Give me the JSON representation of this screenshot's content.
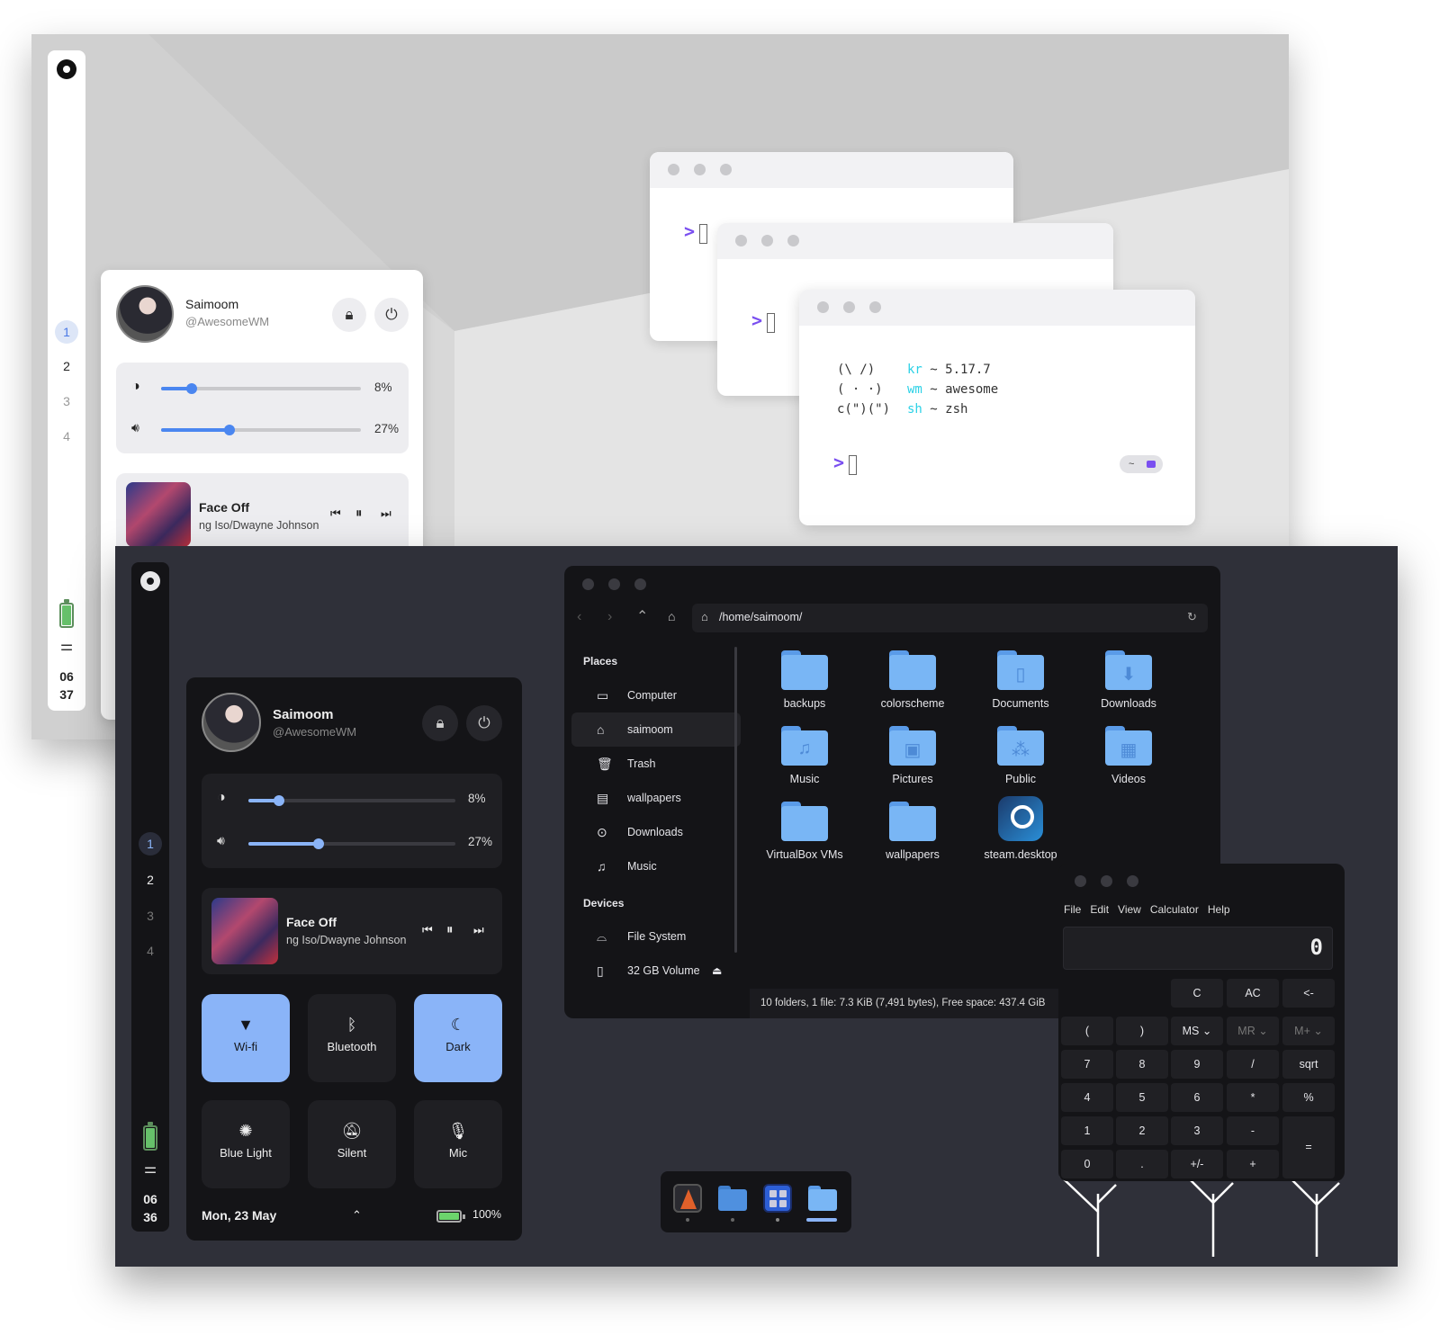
{
  "light": {
    "sidebar": {
      "workspaces": [
        "1",
        "2",
        "3",
        "4"
      ],
      "clock_hour": "06",
      "clock_min": "37"
    },
    "panel": {
      "name": "Saimoom",
      "handle": "@AwesomeWM",
      "brightness": {
        "value": 0.08,
        "label": "8%"
      },
      "volume": {
        "value": 0.27,
        "label": "27%"
      },
      "media": {
        "title": "Face Off",
        "artist": "ng Iso/Dwayne Johnson"
      }
    },
    "terminal": {
      "art": [
        "(\\ /)",
        "( · ·)",
        "c(\")(\")"
      ],
      "info": [
        {
          "key": "kr",
          "val": "~ 5.17.7"
        },
        {
          "key": "wm",
          "val": "~ awesome"
        },
        {
          "key": "sh",
          "val": "~ zsh"
        }
      ],
      "prompt": ">",
      "badge": "~"
    }
  },
  "dark": {
    "sidebar": {
      "workspaces": [
        "1",
        "2",
        "3",
        "4"
      ],
      "clock_hour": "06",
      "clock_min": "36"
    },
    "panel": {
      "name": "Saimoom",
      "handle": "@AwesomeWM",
      "brightness": {
        "value": 0.08,
        "label": "8%"
      },
      "volume": {
        "value": 0.27,
        "label": "27%"
      },
      "media": {
        "title": "Face Off",
        "artist": "ng Iso/Dwayne Johnson"
      },
      "toggles": [
        {
          "label": "Wi-fi",
          "icon": "wifi-icon",
          "active": true
        },
        {
          "label": "Bluetooth",
          "icon": "bluetooth-icon",
          "active": false
        },
        {
          "label": "Dark",
          "icon": "moon-icon",
          "active": true
        },
        {
          "label": "Blue Light",
          "icon": "bulb-icon",
          "active": false
        },
        {
          "label": "Silent",
          "icon": "bell-off-icon",
          "active": false
        },
        {
          "label": "Mic",
          "icon": "mic-icon",
          "active": false
        }
      ],
      "date": "Mon, 23 May",
      "battery": {
        "value": 1.0,
        "label": "100%"
      }
    },
    "filemanager": {
      "path": "/home/saimoom/",
      "places_heading": "Places",
      "places": [
        "Computer",
        "saimoom",
        "Trash",
        "wallpapers",
        "Downloads",
        "Music"
      ],
      "devices_heading": "Devices",
      "devices": [
        "File System",
        "32 GB Volume"
      ],
      "items": [
        "backups",
        "colorscheme",
        "Documents",
        "Downloads",
        "Music",
        "Pictures",
        "Public",
        "Videos",
        "VirtualBox VMs",
        "wallpapers",
        "steam.desktop"
      ],
      "status": "10 folders, 1 file: 7.3 KiB (7,491 bytes), Free space: 437.4 GiB"
    },
    "calculator": {
      "menu": [
        "File",
        "Edit",
        "View",
        "Calculator",
        "Help"
      ],
      "display": "0",
      "row1": [
        "C",
        "AC",
        "<-"
      ],
      "row2": [
        "(",
        ")",
        "MS ⌄",
        "MR ⌄",
        "M+ ⌄"
      ],
      "row3": [
        "7",
        "8",
        "9",
        "/",
        "sqrt"
      ],
      "row4": [
        "4",
        "5",
        "6",
        "*",
        "%"
      ],
      "row5": [
        "1",
        "2",
        "3",
        "-"
      ],
      "row6": [
        "0",
        ".",
        "+/-",
        "+"
      ],
      "equals": "="
    }
  },
  "colors": {
    "accent": "#8ab4f8",
    "slider": "#4a86f0",
    "prompt": "#7a4ff0",
    "cyan": "#2bd1e6",
    "folder": "#79b6f5"
  }
}
